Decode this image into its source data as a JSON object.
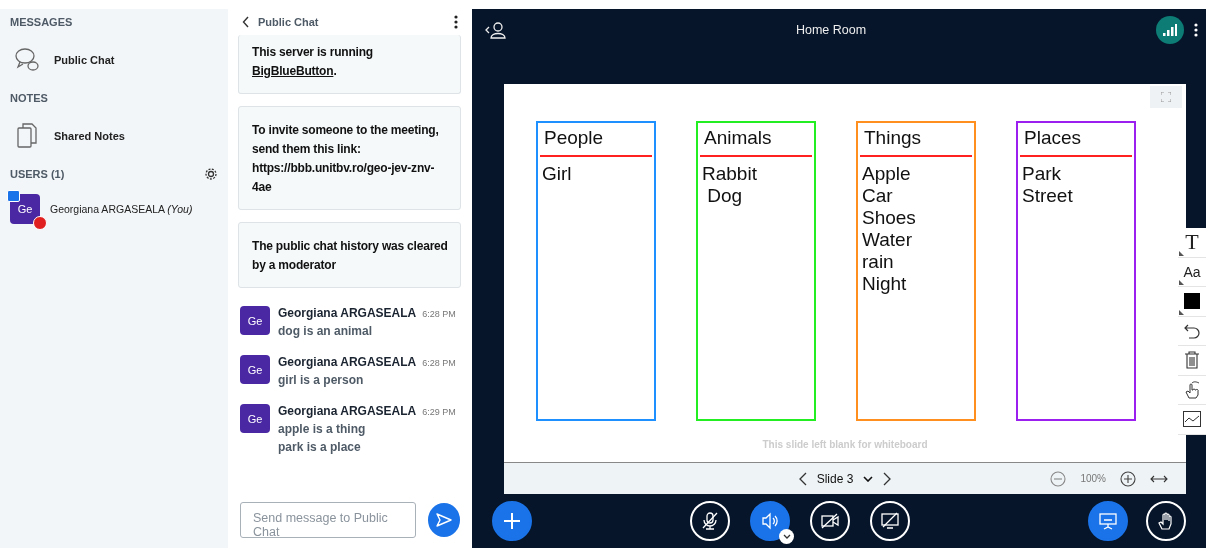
{
  "sidebar": {
    "sections": [
      {
        "title": "MESSAGES",
        "kind": "messages",
        "items": [
          {
            "label": "Public Chat"
          }
        ]
      },
      {
        "title": "NOTES",
        "kind": "notes",
        "items": [
          {
            "label": "Shared Notes"
          }
        ]
      },
      {
        "title": "USERS (1)",
        "kind": "users",
        "users": [
          {
            "initials": "Ge",
            "name": "Georgiana ARGASEALA",
            "suffix": "(You)",
            "presenter": true,
            "muted": true
          }
        ]
      }
    ]
  },
  "chat": {
    "title": "Public Chat",
    "system_messages": [
      {
        "text": "This server is running ",
        "link": "BigBlueButton",
        "after": "."
      },
      {
        "text": "To invite someone to the meeting, send them this link: https://bbb.unitbv.ro/geo-jev-znv-4ae"
      },
      {
        "text": "The public chat history was cleared by a moderator"
      }
    ],
    "messages": [
      {
        "initials": "Ge",
        "author": "Georgiana ARGASEALA",
        "time": "6:28 PM",
        "lines": [
          "dog is an animal"
        ]
      },
      {
        "initials": "Ge",
        "author": "Georgiana ARGASEALA",
        "time": "6:28 PM",
        "lines": [
          "girl is a person"
        ]
      },
      {
        "initials": "Ge",
        "author": "Georgiana ARGASEALA",
        "time": "6:29 PM",
        "lines": [
          "apple is a thing",
          "park is a place"
        ]
      }
    ],
    "input": {
      "placeholder": "Send message to Public Chat"
    }
  },
  "meeting": {
    "title": "Home Room"
  },
  "whiteboard": {
    "columns": [
      {
        "heading": "People",
        "color": "#1e90ff",
        "items": [
          "Girl"
        ]
      },
      {
        "heading": "Animals",
        "color": "#22ee22",
        "items": [
          "Rabbit",
          " Dog"
        ]
      },
      {
        "heading": "Things",
        "color": "#ff9020",
        "items": [
          "Apple",
          "Car",
          "Shoes",
          "Water",
          "rain",
          "Night"
        ]
      },
      {
        "heading": "Places",
        "color": "#9b20f0",
        "items": [
          "Park",
          "Street"
        ]
      }
    ],
    "caption": "This slide left blank for whiteboard",
    "slide_label": "Slide 3",
    "zoom": "100%",
    "tools": [
      {
        "kind": "text",
        "label": "T"
      },
      {
        "kind": "font",
        "label": "Aa"
      },
      {
        "kind": "color"
      },
      {
        "kind": "undo"
      },
      {
        "kind": "clear"
      },
      {
        "kind": "pan"
      },
      {
        "kind": "multi"
      }
    ]
  },
  "controls": [
    {
      "kind": "mic",
      "active": false
    },
    {
      "kind": "audio",
      "active": true
    },
    {
      "kind": "camera",
      "active": false
    },
    {
      "kind": "screen",
      "active": false
    }
  ],
  "presentation_active": true
}
